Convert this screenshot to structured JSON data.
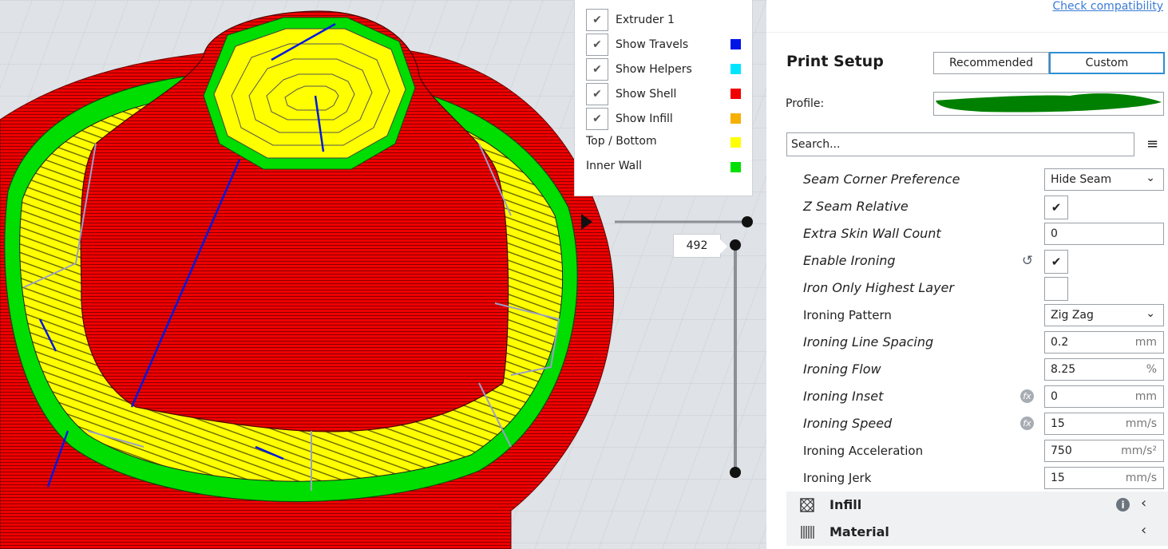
{
  "legend": {
    "items": [
      {
        "label": "Extruder 1",
        "checked": true,
        "color": ""
      },
      {
        "label": "Show Travels",
        "checked": true,
        "color": "#0014e6"
      },
      {
        "label": "Show Helpers",
        "checked": true,
        "color": "#00e5ff"
      },
      {
        "label": "Show Shell",
        "checked": true,
        "color": "#f00000"
      },
      {
        "label": "Show Infill",
        "checked": true,
        "color": "#f5b000"
      },
      {
        "label": "Top / Bottom",
        "checked": null,
        "color": "#ffff00"
      },
      {
        "label": "Inner Wall",
        "checked": null,
        "color": "#00e000"
      }
    ]
  },
  "layer_slider": {
    "current_layer": "492"
  },
  "panel": {
    "check_compatibility": "Check compatibility",
    "title": "Print Setup",
    "modes": {
      "recommended": "Recommended",
      "custom": "Custom",
      "selected": "Custom"
    },
    "profile_label": "Profile:",
    "search_placeholder": "Search...",
    "menu_icon": "hamburger-icon",
    "settings": [
      {
        "label": "Seam Corner Preference",
        "italic": true,
        "type": "dropdown",
        "value": "Hide Seam"
      },
      {
        "label": "Z Seam Relative",
        "italic": true,
        "type": "checkbox",
        "checked": true
      },
      {
        "label": "Extra Skin Wall Count",
        "italic": true,
        "type": "text",
        "value": "0",
        "unit": ""
      },
      {
        "label": "Enable Ironing",
        "italic": true,
        "type": "checkbox",
        "checked": true,
        "icon": "reset-icon"
      },
      {
        "label": "Iron Only Highest Layer",
        "italic": true,
        "type": "checkbox",
        "checked": false
      },
      {
        "label": "Ironing Pattern",
        "italic": false,
        "type": "dropdown",
        "value": "Zig Zag"
      },
      {
        "label": "Ironing Line Spacing",
        "italic": true,
        "type": "text",
        "value": "0.2",
        "unit": "mm"
      },
      {
        "label": "Ironing Flow",
        "italic": true,
        "type": "text",
        "value": "8.25",
        "unit": "%"
      },
      {
        "label": "Ironing Inset",
        "italic": true,
        "type": "text",
        "value": "0",
        "unit": "mm",
        "icon": "function-icon"
      },
      {
        "label": "Ironing Speed",
        "italic": true,
        "type": "text",
        "value": "15",
        "unit": "mm/s",
        "icon": "function-icon"
      },
      {
        "label": "Ironing Acceleration",
        "italic": false,
        "type": "text",
        "value": "750",
        "unit": "mm/s²"
      },
      {
        "label": "Ironing Jerk",
        "italic": false,
        "type": "text",
        "value": "15",
        "unit": "mm/s"
      }
    ],
    "sections": [
      {
        "label": "Infill",
        "icon": "infill-icon",
        "info": true
      },
      {
        "label": "Material",
        "icon": "material-icon",
        "info": false
      }
    ]
  }
}
